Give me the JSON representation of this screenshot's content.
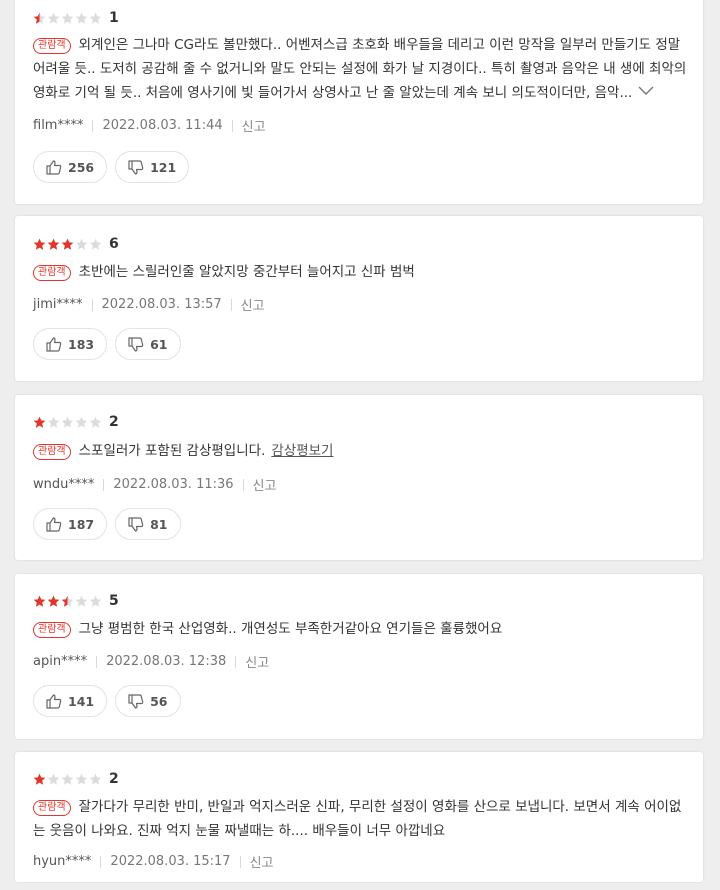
{
  "colors": {
    "accent": "#e0362c",
    "star_on": "#e0362c",
    "star_off": "#dcdcdc",
    "card_bg": "#ffffff",
    "page_bg": "#eeeeee"
  },
  "reviews": [
    {
      "stars_filled": 0.5,
      "score": "1",
      "badge": "관람객",
      "text": "외계인은 그나마 CG라도 볼만했다.. 어벤져스급 초호화 배우들을 데리고 이런 망작을 일부러 만들기도 정말 어려울 듯.. 도저히 공감해 줄 수 없거니와 말도 안되는 설정에 화가 날 지경이다.. 특히 촬영과 음악은 내 생에 최악의 영화로 기억 될 듯.. 처음에 영사기에 빛 들어가서 상영사고 난 줄 알았는데 계속 보니 의도적이더만, 음악...",
      "user": "film****",
      "date": "2022.08.03. 11:44",
      "report": "신고",
      "likes": "256",
      "dislikes": "121"
    },
    {
      "stars_filled": 3,
      "score": "6",
      "badge": "관람객",
      "text": "초반에는 스릴러인줄 알았지망 중간부터 늘어지고 신파 범벅",
      "user": "jimi****",
      "date": "2022.08.03. 13:57",
      "report": "신고",
      "likes": "183",
      "dislikes": "61"
    },
    {
      "stars_filled": 1,
      "score": "2",
      "badge": "관람객",
      "text": "스포일러가 포함된 감상평입니다.",
      "spoiler_link": "감상평보기",
      "user": "wndu****",
      "date": "2022.08.03. 11:36",
      "report": "신고",
      "likes": "187",
      "dislikes": "81"
    },
    {
      "stars_filled": 2.5,
      "score": "5",
      "badge": "관람객",
      "text": "그냥 평범한 한국 산업영화.. 개연성도 부족한거같아요 연기들은 훌륭했어요",
      "user": "apin****",
      "date": "2022.08.03. 12:38",
      "report": "신고",
      "likes": "141",
      "dislikes": "56"
    },
    {
      "stars_filled": 1,
      "score": "2",
      "badge": "관람객",
      "text": "잘가다가 무리한 반미, 반일과 억지스러운 신파, 무리한 설정이 영화를 산으로 보냅니다. 보면서 계속 어이없는 웃음이 나와요. 진짜 억지 눈물 짜낼때는 하.... 배우들이 너무 아깝네요",
      "user": "hyun****",
      "date": "2022.08.03. 15:17",
      "report": "신고"
    }
  ]
}
